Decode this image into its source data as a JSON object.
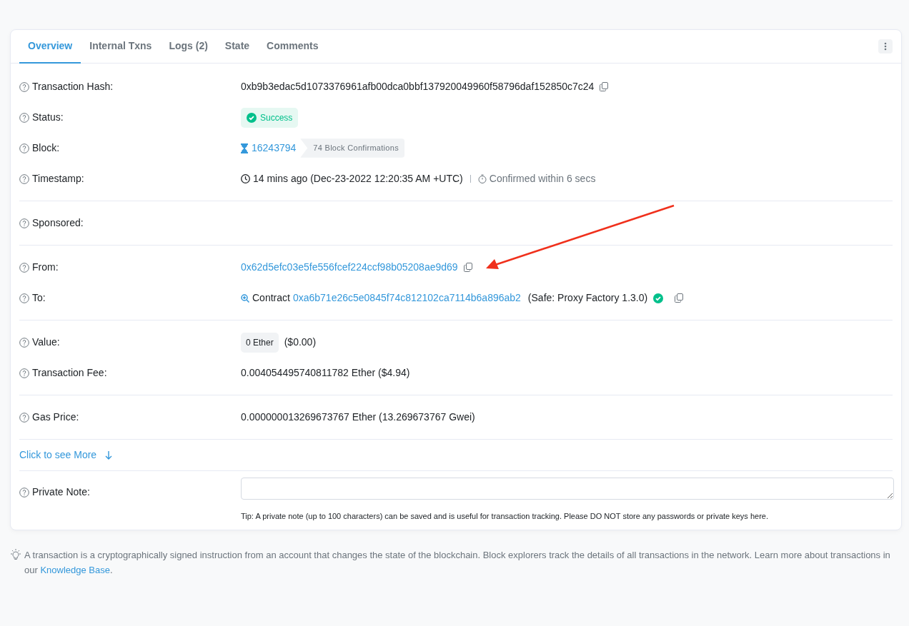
{
  "tabs": [
    {
      "label": "Overview",
      "selected": true
    },
    {
      "label": "Internal Txns",
      "selected": false
    },
    {
      "label": "Logs (2)",
      "selected": false
    },
    {
      "label": "State",
      "selected": false
    },
    {
      "label": "Comments",
      "selected": false
    }
  ],
  "sections": [
    {
      "rows": [
        {
          "kind": "copy-text",
          "label": "Transaction Hash:",
          "value": "0xb9b3edac5d1073376961afb00dca0bbf137920049960f58796daf152850c7c24"
        },
        {
          "kind": "status",
          "label": "Status:",
          "value": "Success"
        },
        {
          "kind": "block",
          "label": "Block:",
          "value": "16243794",
          "confirmations": "74 Block Confirmations"
        },
        {
          "kind": "timestamp",
          "label": "Timestamp:",
          "value": "14 mins ago (Dec-23-2022 12:20:35 AM +UTC)",
          "confirmed": "Confirmed within 6 secs"
        }
      ]
    },
    {
      "rows": [
        {
          "kind": "empty",
          "label": "Sponsored:"
        }
      ]
    },
    {
      "rows": [
        {
          "kind": "address",
          "label": "From:",
          "value": "0x62d5efc03e5fe556fcef224ccf98b05208ae9d69"
        },
        {
          "kind": "contract",
          "label": "To:",
          "prefix": "Contract",
          "value": "0xa6b71e26c5e0845f74c812102ca7114b6a896ab2",
          "name": "(Safe: Proxy Factory 1.3.0)",
          "verified": true
        }
      ]
    },
    {
      "rows": [
        {
          "kind": "value",
          "label": "Value:",
          "badge": "0 Ether",
          "value": "($0.00)"
        },
        {
          "kind": "text",
          "label": "Transaction Fee:",
          "value": "0.004054495740811782 Ether ($4.94)"
        }
      ]
    },
    {
      "rows": [
        {
          "kind": "text",
          "label": "Gas Price:",
          "value": "0.000000013269673767 Ether (13.269673767 Gwei)"
        }
      ]
    }
  ],
  "more_link": "Click to see More",
  "private_note": {
    "label": "Private Note:",
    "tip": "Tip: A private note (up to 100 characters) can be saved and is useful for transaction tracking. Please DO NOT store any passwords or private keys here."
  },
  "footer": {
    "text": "A transaction is a cryptographically signed instruction from an account that changes the state of the blockchain. Block explorers track the details of all transactions in the network. Learn more about transactions in our",
    "link": "Knowledge Base",
    "end": "."
  }
}
